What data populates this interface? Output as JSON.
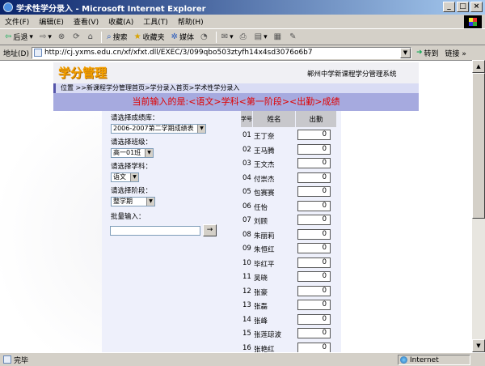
{
  "window": {
    "title": "学术性学分录入 - Microsoft Internet Explorer",
    "minimize": "_",
    "maximize": "□",
    "close": "×"
  },
  "menu": [
    "文件(F)",
    "编辑(E)",
    "查看(V)",
    "收藏(A)",
    "工具(T)",
    "帮助(H)"
  ],
  "toolbar": {
    "back": "后退",
    "search": "搜索",
    "favorites": "收藏夹",
    "media": "媒体"
  },
  "address": {
    "label": "地址(D)",
    "url": "http://cj.yxms.edu.cn/xf/xfxt.dll/EXEC/3/099qbo503ztyfh14x4sd3076o6b7",
    "go": "转到",
    "links": "链接"
  },
  "page": {
    "logo": "学分管理",
    "school": "郸州中学新课程学分管理系统",
    "breadcrumb": "位置 >>新课程学分管理首页>学分录入首页>学术性学分录入",
    "banner": "当前输入的是:<语文>学科<第一阶段><出勤>成绩",
    "form": {
      "grade_label": "请选择成绩库：",
      "grade_value": "2006-2007第二学期成绩表",
      "class_label": "请选择班级：",
      "class_value": "高一01班",
      "subject_label": "请选择学科：",
      "subject_value": "语文",
      "stage_label": "请选择阶段：",
      "stage_value": "整学期",
      "batch_label": "批量输入：",
      "batch_button": "→"
    },
    "table": {
      "col_no": "学号",
      "col_name": "姓名",
      "col_attend": "出勤",
      "rows": [
        {
          "no": "01",
          "name": "王丁奈",
          "score": "0"
        },
        {
          "no": "02",
          "name": "王马腾",
          "score": "0"
        },
        {
          "no": "03",
          "name": "王文杰",
          "score": "0"
        },
        {
          "no": "04",
          "name": "付崇杰",
          "score": "0"
        },
        {
          "no": "05",
          "name": "包赛赛",
          "score": "0"
        },
        {
          "no": "06",
          "name": "任怡",
          "score": "0"
        },
        {
          "no": "07",
          "name": "刘顾",
          "score": "0"
        },
        {
          "no": "08",
          "name": "朱丽莉",
          "score": "0"
        },
        {
          "no": "09",
          "name": "朱恒红",
          "score": "0"
        },
        {
          "no": "10",
          "name": "毕红平",
          "score": "0"
        },
        {
          "no": "11",
          "name": "吴晓",
          "score": "0"
        },
        {
          "no": "12",
          "name": "张豪",
          "score": "0"
        },
        {
          "no": "13",
          "name": "张磊",
          "score": "0"
        },
        {
          "no": "14",
          "name": "张峰",
          "score": "0"
        },
        {
          "no": "15",
          "name": "张莲琼波",
          "score": "0"
        },
        {
          "no": "16",
          "name": "张艳红",
          "score": "0"
        }
      ]
    }
  },
  "status": {
    "text": "完毕",
    "zone": "Internet"
  }
}
